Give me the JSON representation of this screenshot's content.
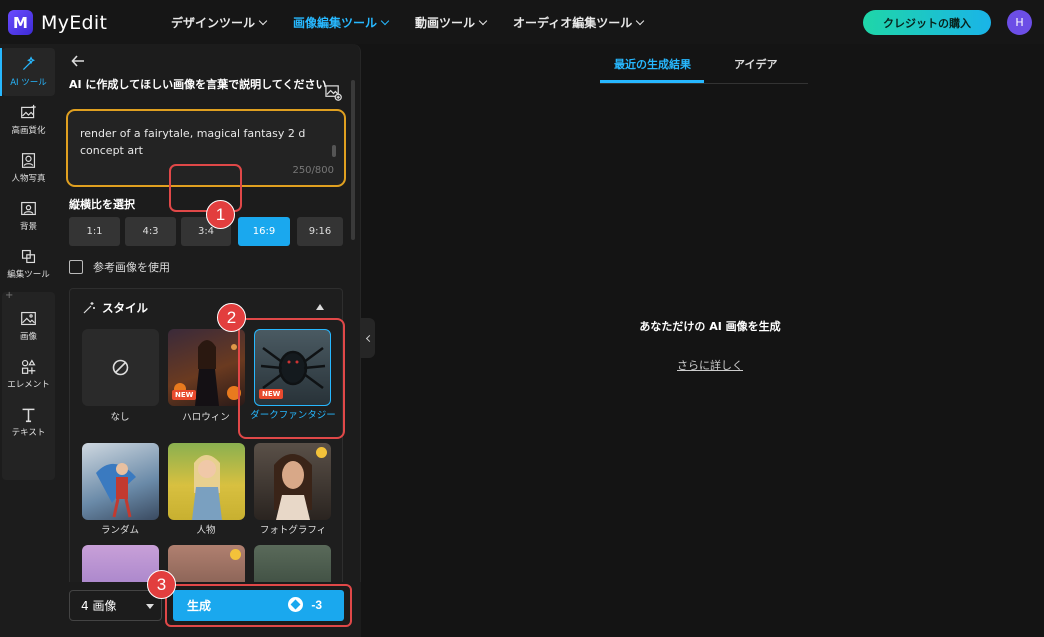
{
  "app": {
    "name": "MyEdit",
    "logo_letter": "M"
  },
  "nav": [
    {
      "label": "デザインツール",
      "active": false
    },
    {
      "label": "画像編集ツール",
      "active": true
    },
    {
      "label": "動画ツール",
      "active": false
    },
    {
      "label": "オーディオ編集ツール",
      "active": false
    }
  ],
  "header": {
    "credit_button": "クレジットの購入",
    "avatar_initial": "H"
  },
  "rail": [
    {
      "label": "AI ツール",
      "icon": "magic-wand-icon",
      "active": true
    },
    {
      "label": "高画質化",
      "icon": "image-enhance-icon"
    },
    {
      "label": "人物写真",
      "icon": "portrait-icon"
    },
    {
      "label": "背景",
      "icon": "background-icon"
    },
    {
      "label": "編集ツール",
      "icon": "edit-tools-icon"
    },
    {
      "label": "画像",
      "icon": "image-icon"
    },
    {
      "label": "エレメント",
      "icon": "elements-icon"
    },
    {
      "label": "テキスト",
      "icon": "text-icon"
    }
  ],
  "panel": {
    "prompt_label": "AI に作成してほしい画像を言葉で説明してください",
    "prompt_text": "render of a fairytale, magical fantasy 2 d concept art",
    "prompt_counter": "250/800",
    "ratio_label": "縦横比を選択",
    "ratios": [
      "1:1",
      "4:3",
      "3:4",
      "16:9",
      "9:16"
    ],
    "ratio_selected": "16:9",
    "reference_label": "参考画像を使用",
    "style_title": "スタイル",
    "styles": [
      {
        "label": "なし",
        "new": false
      },
      {
        "label": "ハロウィン",
        "new": true,
        "badge": "NEW"
      },
      {
        "label": "ダークファンタジー",
        "new": true,
        "badge": "NEW",
        "selected": true
      },
      {
        "label": "ランダム"
      },
      {
        "label": "人物"
      },
      {
        "label": "フォトグラフィ",
        "premium": true
      }
    ],
    "image_count": "4 画像",
    "generate_label": "生成",
    "generate_cost": "-3"
  },
  "annotations": [
    "1",
    "2",
    "3"
  ],
  "main": {
    "tabs": [
      "最近の生成結果",
      "アイデア"
    ],
    "message": "あなただけの AI 画像を生成",
    "link": "さらに詳しく"
  },
  "colors": {
    "accent": "#1aa8ee",
    "highlight": "#e04848",
    "prompt_border": "#e0a020"
  }
}
